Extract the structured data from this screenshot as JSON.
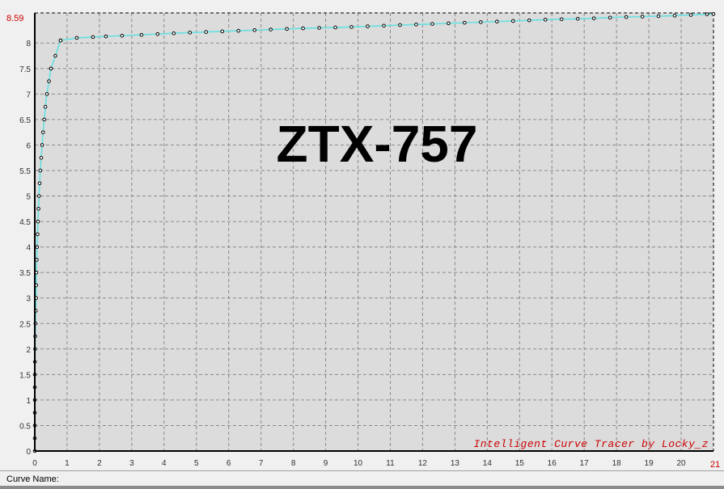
{
  "chart_data": {
    "type": "line",
    "title": "ZTX-757",
    "xlim": [
      0,
      21
    ],
    "ylim": [
      0,
      8.59
    ],
    "x_ticks": [
      0,
      1,
      2,
      3,
      4,
      5,
      6,
      7,
      8,
      9,
      10,
      11,
      12,
      13,
      14,
      15,
      16,
      17,
      18,
      19,
      20,
      21
    ],
    "y_ticks": [
      0,
      0.5,
      1,
      1.5,
      2,
      2.5,
      3,
      3.5,
      4,
      4.5,
      5,
      5.5,
      6,
      6.5,
      7,
      7.5,
      8
    ],
    "x_max_label": "21",
    "y_max_label": "8.59",
    "grid": true,
    "series": [
      {
        "color": "#66e0e0",
        "x": [
          0,
          0,
          0,
          0,
          0.01,
          0.02,
          0.04,
          0.05,
          0.07,
          0.1,
          0.13,
          0.17,
          0.25,
          0.35,
          0.5,
          0.8,
          1.3,
          2.2,
          3.3,
          4.6,
          5.9,
          7.1,
          8.4,
          9.6,
          10.8,
          12.1,
          13.4,
          14.7,
          15.9,
          17.1,
          18.3,
          19.5,
          20.7,
          21
        ],
        "y": [
          0,
          0.5,
          1.0,
          1.5,
          2.0,
          2.5,
          3.0,
          3.5,
          4.0,
          4.5,
          5.0,
          5.5,
          6.2,
          6.9,
          7.5,
          8.05,
          8.1,
          8.13,
          8.16,
          8.2,
          8.23,
          8.26,
          8.29,
          8.31,
          8.34,
          8.37,
          8.4,
          8.43,
          8.46,
          8.48,
          8.51,
          8.53,
          8.56,
          8.57
        ]
      }
    ],
    "marker_y_values": [
      0,
      0.25,
      0.5,
      0.75,
      1.0,
      1.25,
      1.5,
      1.75,
      2.0,
      2.25,
      2.5,
      2.75,
      3.0,
      3.25,
      3.5,
      3.75,
      4.0,
      4.25,
      4.5,
      4.75,
      5.0,
      5.25,
      5.5,
      5.75,
      6.0,
      6.25,
      6.5,
      6.75,
      7.0,
      7.25,
      7.5,
      7.75,
      8.05
    ],
    "marker_x_values": [
      0.5,
      0.8,
      1.3,
      1.8,
      2.2,
      2.7,
      3.3,
      3.8,
      4.3,
      4.8,
      5.3,
      5.8,
      6.3,
      6.8,
      7.3,
      7.8,
      8.3,
      8.8,
      9.3,
      9.8,
      10.3,
      10.8,
      11.3,
      11.8,
      12.3,
      12.8,
      13.3,
      13.8,
      14.3,
      14.8,
      15.3,
      15.8,
      16.3,
      16.8,
      17.3,
      17.8,
      18.3,
      18.8,
      19.3,
      19.8,
      20.3,
      20.8,
      21.0
    ],
    "watermark": "Intelligent Curve Tracer by Locky_z"
  },
  "colors": {
    "plot_bg": "#dcdcdc",
    "grid": "#8a8a8a",
    "curve": "#66e0e0",
    "axis_label": "#333333",
    "max_label": "#cc0000",
    "watermark": "#cc0000",
    "title": "#000000"
  },
  "status": {
    "curve_name_label": "Curve Name:"
  }
}
